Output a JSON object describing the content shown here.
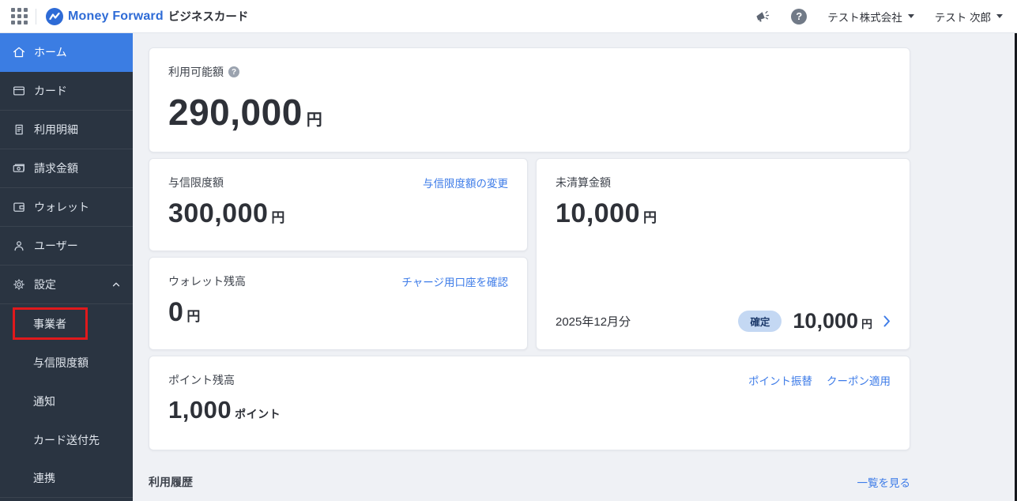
{
  "header": {
    "brand": "Money Forward",
    "product": "ビジネスカード",
    "company_selector": "テスト株式会社",
    "user_selector": "テスト 次郎",
    "help_glyph": "?"
  },
  "sidebar": {
    "items": [
      {
        "label": "ホーム",
        "icon": "home-icon",
        "active": true
      },
      {
        "label": "カード",
        "icon": "card-icon",
        "active": false
      },
      {
        "label": "利用明細",
        "icon": "statement-icon",
        "active": false
      },
      {
        "label": "請求金額",
        "icon": "billing-icon",
        "active": false
      },
      {
        "label": "ウォレット",
        "icon": "wallet-icon",
        "active": false
      },
      {
        "label": "ユーザー",
        "icon": "user-icon",
        "active": false
      },
      {
        "label": "設定",
        "icon": "gear-icon",
        "active": false,
        "expanded": true
      }
    ],
    "settings_subitems": [
      {
        "label": "事業者",
        "annotated": true
      },
      {
        "label": "与信限度額"
      },
      {
        "label": "通知"
      },
      {
        "label": "カード送付先"
      },
      {
        "label": "連携"
      }
    ]
  },
  "main": {
    "available": {
      "label": "利用可能額",
      "amount": "290,000",
      "unit": "円"
    },
    "credit_limit": {
      "label": "与信限度額",
      "link": "与信限度額の変更",
      "amount": "300,000",
      "unit": "円"
    },
    "wallet": {
      "label": "ウォレット残高",
      "link": "チャージ用口座を確認",
      "amount": "0",
      "unit": "円"
    },
    "unsettled": {
      "label": "未清算金額",
      "amount": "10,000",
      "unit": "円",
      "period": "2025年12月分",
      "badge": "確定",
      "period_amount": "10,000",
      "period_unit": "円"
    },
    "points": {
      "label": "ポイント残高",
      "links": [
        "ポイント振替",
        "クーポン適用"
      ],
      "amount": "1,000",
      "unit": "ポイント"
    },
    "history": {
      "title": "利用履歴",
      "link": "一覧を見る"
    }
  },
  "colors": {
    "accent_blue": "#3B7DE3",
    "link_blue": "#3E7CE8",
    "sidebar_bg": "#2A3441",
    "brand_blue": "#2E6BD6",
    "badge_bg": "#C4D8F3",
    "badge_text": "#1D3A6B",
    "annotation_red": "#E0191C",
    "main_bg": "#EFF1F5"
  }
}
